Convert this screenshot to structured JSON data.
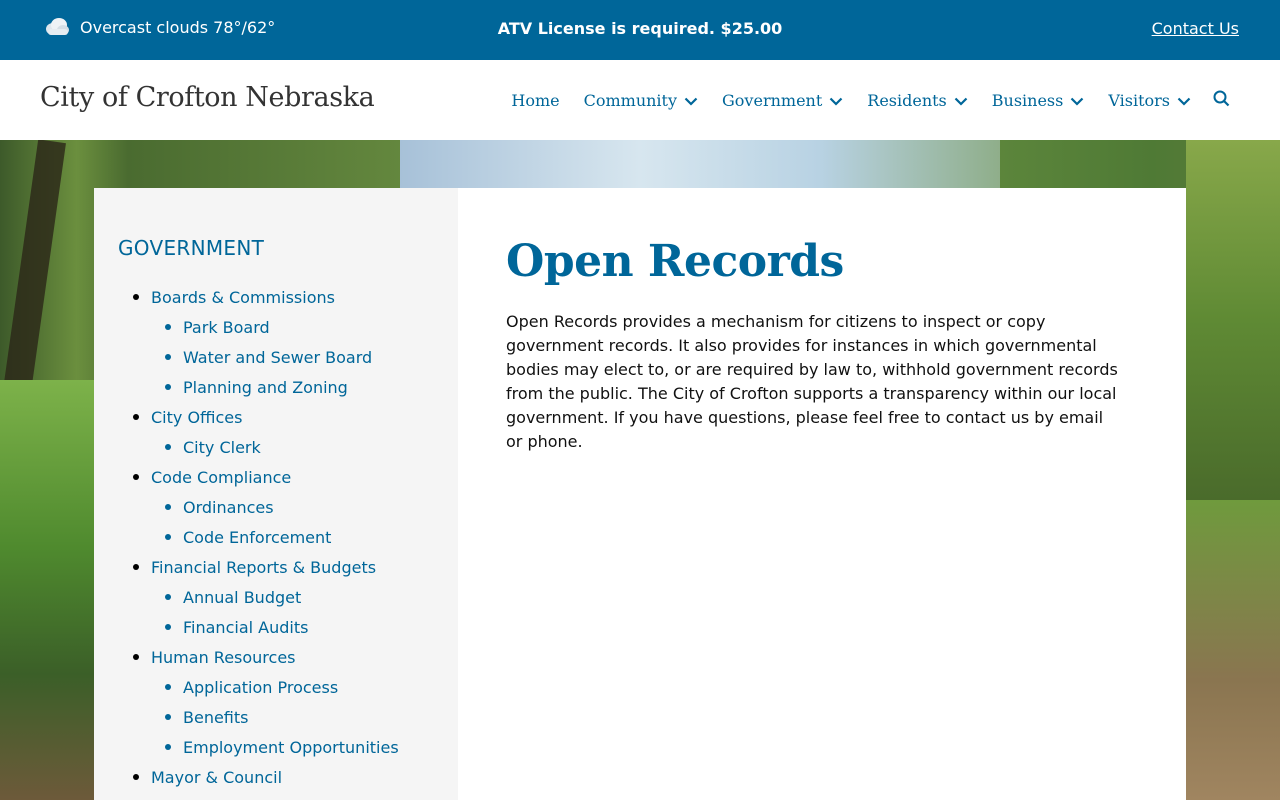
{
  "topbar": {
    "weather_text": "Overcast clouds 78°/62°",
    "weather_icon": "cloud-icon",
    "notice": "ATV License is required. $25.00",
    "contact_label": "Contact Us"
  },
  "header": {
    "site_title": "City of Crofton Nebraska",
    "nav": [
      {
        "label": "Home",
        "dropdown": false
      },
      {
        "label": "Community",
        "dropdown": true
      },
      {
        "label": "Government",
        "dropdown": true
      },
      {
        "label": "Residents",
        "dropdown": true
      },
      {
        "label": "Business",
        "dropdown": true
      },
      {
        "label": "Visitors",
        "dropdown": true
      }
    ],
    "search_icon": "search-icon"
  },
  "sidebar": {
    "heading": "GOVERNMENT",
    "items": [
      {
        "label": "Boards & Commissions",
        "level": 1
      },
      {
        "label": "Park Board",
        "level": 2
      },
      {
        "label": "Water and Sewer Board",
        "level": 2
      },
      {
        "label": "Planning and Zoning",
        "level": 2
      },
      {
        "label": "City Offices",
        "level": 1
      },
      {
        "label": "City Clerk",
        "level": 2
      },
      {
        "label": "Code Compliance",
        "level": 1
      },
      {
        "label": "Ordinances",
        "level": 2
      },
      {
        "label": "Code Enforcement",
        "level": 2
      },
      {
        "label": "Financial Reports & Budgets",
        "level": 1
      },
      {
        "label": "Annual Budget",
        "level": 2
      },
      {
        "label": "Financial Audits",
        "level": 2
      },
      {
        "label": "Human Resources",
        "level": 1
      },
      {
        "label": "Application Process",
        "level": 2
      },
      {
        "label": "Benefits",
        "level": 2
      },
      {
        "label": "Employment Opportunities",
        "level": 2
      },
      {
        "label": "Mayor & Council",
        "level": 1
      }
    ]
  },
  "main": {
    "title": "Open Records",
    "body": "Open Records provides a mechanism for citizens to inspect or copy government records. It also provides for instances in which governmental bodies may elect to, or are required by law to, withhold government records from the public. The City of Crofton supports a transparency within our local government.  If you have questions, please feel free to contact us by email or phone."
  },
  "colors": {
    "brand": "#006699",
    "sidebar_bg": "#f5f5f5"
  }
}
